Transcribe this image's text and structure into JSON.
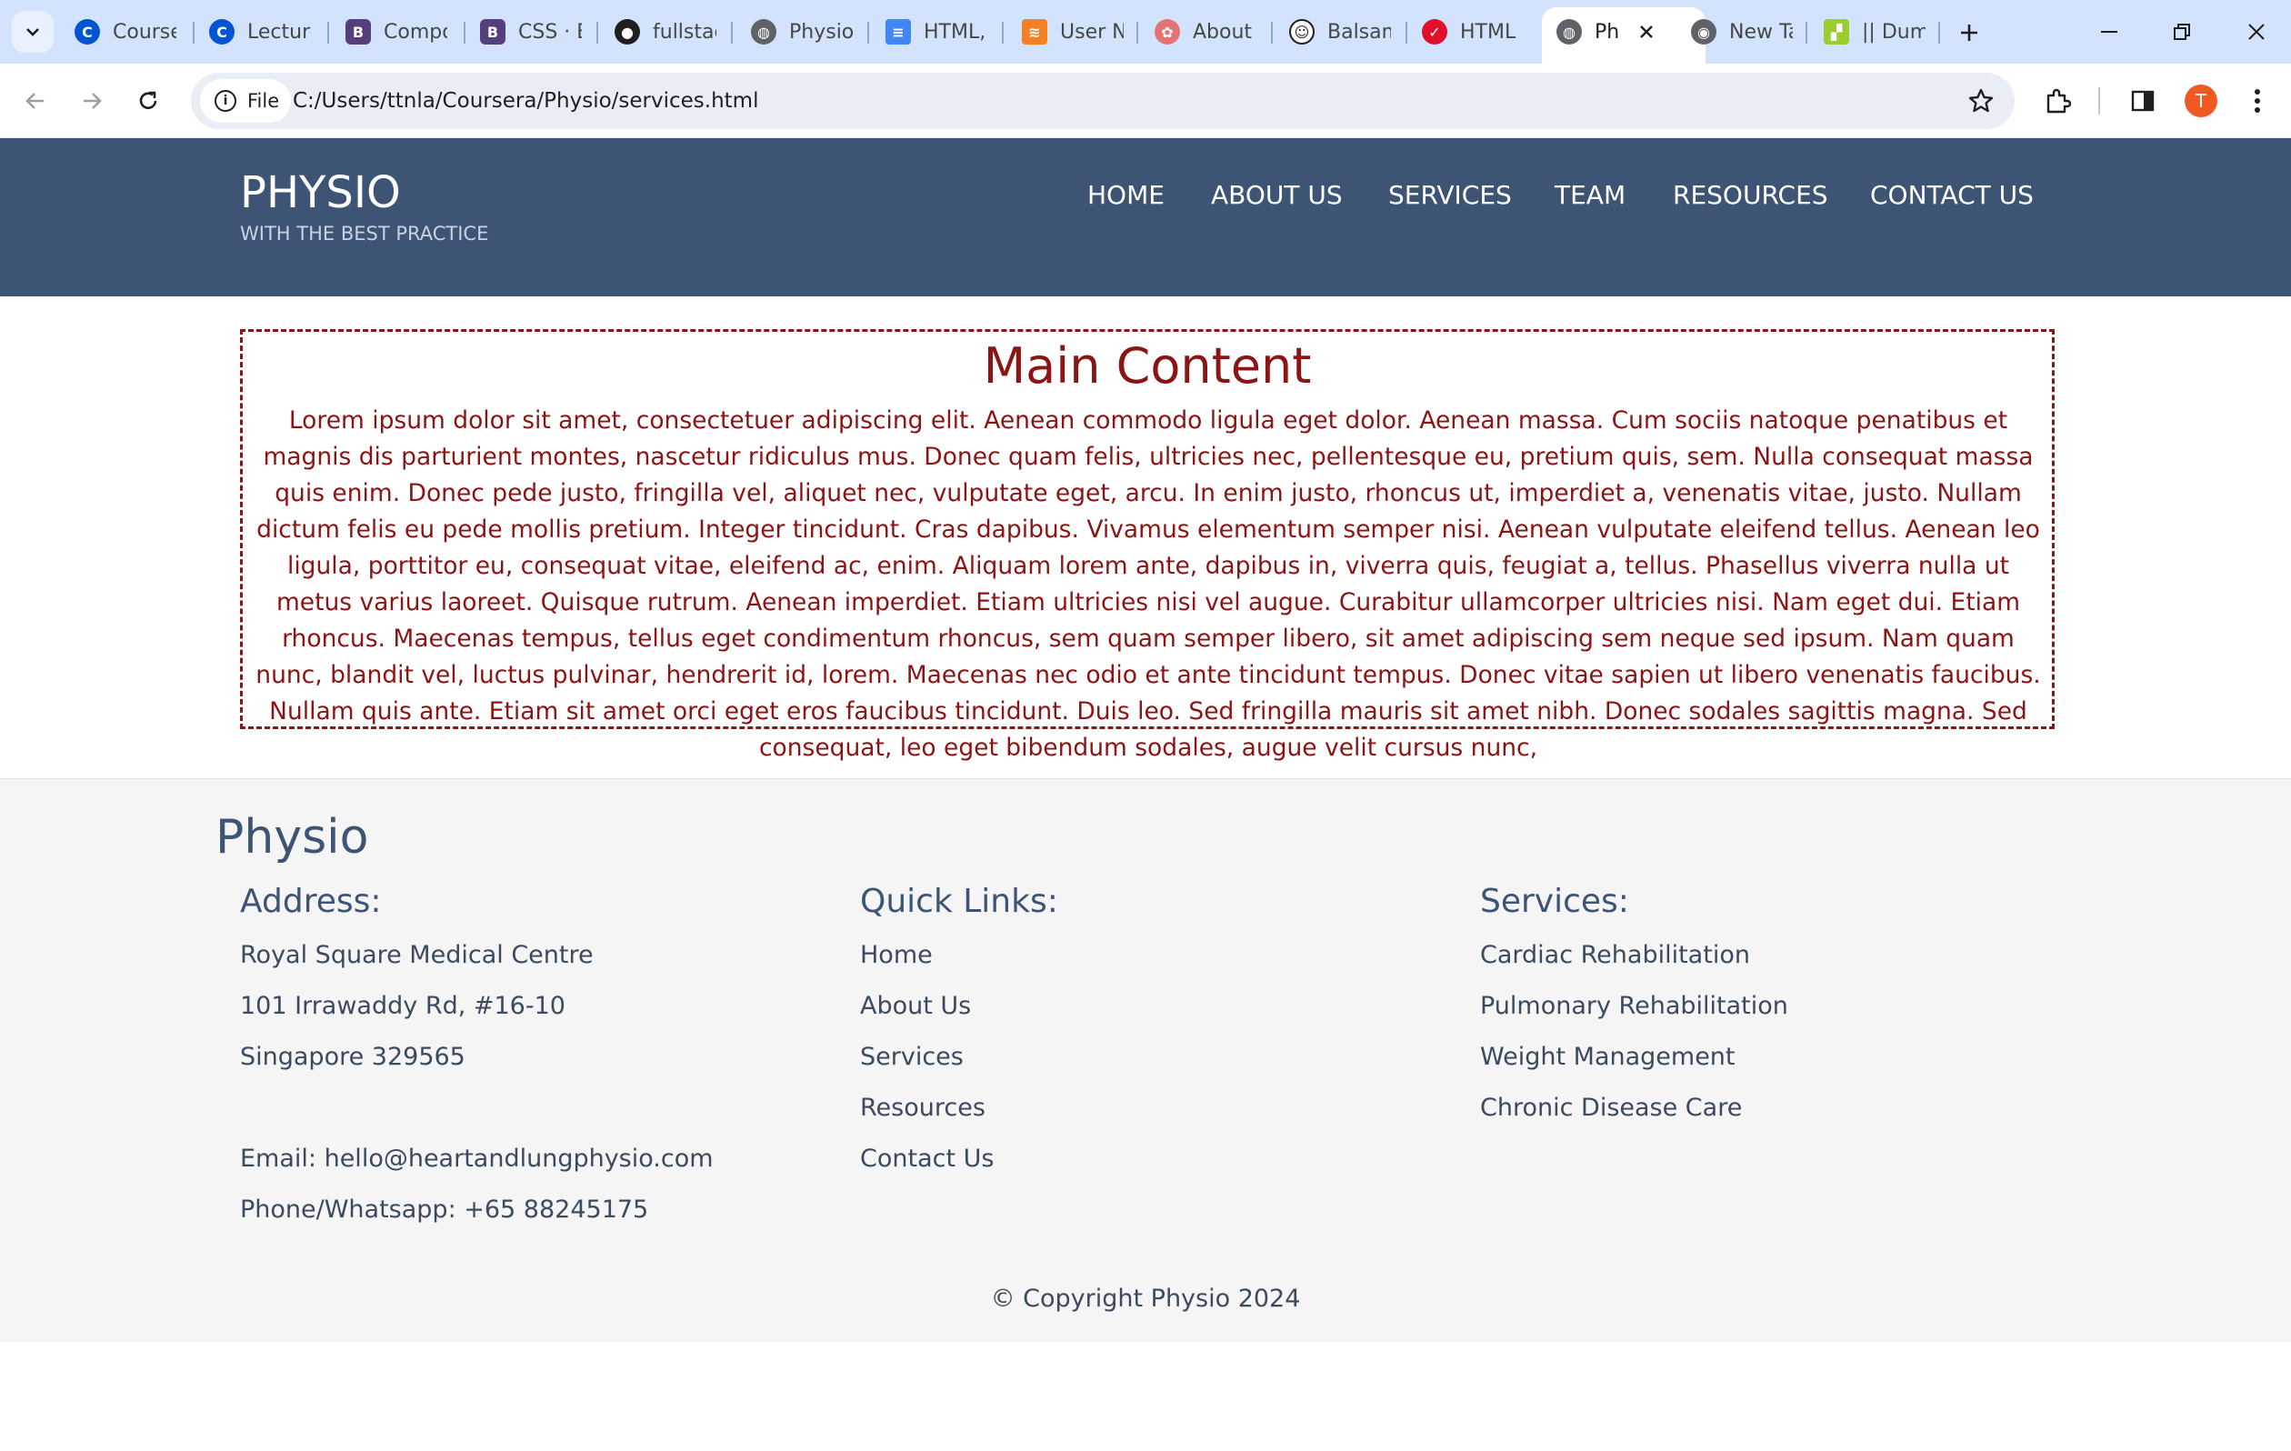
{
  "browser": {
    "tabs": [
      {
        "title": "Course",
        "icon": "coursera-icon",
        "color": "#0056d2"
      },
      {
        "title": "Lecture",
        "icon": "coursera-icon",
        "color": "#0056d2"
      },
      {
        "title": "Compo",
        "icon": "bootstrap-icon",
        "color": "#563d7c"
      },
      {
        "title": "CSS · B",
        "icon": "bootstrap-icon",
        "color": "#563d7c"
      },
      {
        "title": "fullstac",
        "icon": "github-icon",
        "color": "#1f1f1f"
      },
      {
        "title": "Physio",
        "icon": "globe-icon",
        "color": "#5f6368"
      },
      {
        "title": "HTML,",
        "icon": "docs-icon",
        "color": "#4285f4"
      },
      {
        "title": "User N",
        "icon": "stackoverflow-icon",
        "color": "#f48024"
      },
      {
        "title": "About",
        "icon": "about-icon",
        "color": "#e57373"
      },
      {
        "title": "Balsam",
        "icon": "smiley-icon",
        "color": "#1f1f1f"
      },
      {
        "title": "HTML (",
        "icon": "htmlcheck-icon",
        "color": "#e0102b"
      },
      {
        "title": "Ph",
        "icon": "globe-icon",
        "color": "#5f6368",
        "active": true
      },
      {
        "title": "New Ta",
        "icon": "chrome-icon",
        "color": "#5f6368"
      },
      {
        "title": "|| Dum",
        "icon": "dummy-icon",
        "color": "#9acd32"
      }
    ],
    "file_chip": "File",
    "url": "C:/Users/ttnla/Coursera/Physio/services.html",
    "avatar_letter": "T"
  },
  "header": {
    "brand": "PHYSIO",
    "tagline": "WITH THE BEST PRACTICE",
    "nav": [
      "HOME",
      "ABOUT US",
      "SERVICES",
      "TEAM",
      "RESOURCES",
      "CONTACT US"
    ]
  },
  "main": {
    "title": "Main Content",
    "text": "Lorem ipsum dolor sit amet, consectetuer adipiscing elit. Aenean commodo ligula eget dolor. Aenean massa. Cum sociis natoque penatibus et magnis dis parturient montes, nascetur ridiculus mus. Donec quam felis, ultricies nec, pellentesque eu, pretium quis, sem. Nulla consequat massa quis enim. Donec pede justo, fringilla vel, aliquet nec, vulputate eget, arcu. In enim justo, rhoncus ut, imperdiet a, venenatis vitae, justo. Nullam dictum felis eu pede mollis pretium. Integer tincidunt. Cras dapibus. Vivamus elementum semper nisi. Aenean vulputate eleifend tellus. Aenean leo ligula, porttitor eu, consequat vitae, eleifend ac, enim. Aliquam lorem ante, dapibus in, viverra quis, feugiat a, tellus. Phasellus viverra nulla ut metus varius laoreet. Quisque rutrum. Aenean imperdiet. Etiam ultricies nisi vel augue. Curabitur ullamcorper ultricies nisi. Nam eget dui. Etiam rhoncus. Maecenas tempus, tellus eget condimentum rhoncus, sem quam semper libero, sit amet adipiscing sem neque sed ipsum. Nam quam nunc, blandit vel, luctus pulvinar, hendrerit id, lorem. Maecenas nec odio et ante tincidunt tempus. Donec vitae sapien ut libero venenatis faucibus. Nullam quis ante. Etiam sit amet orci eget eros faucibus tincidunt. Duis leo. Sed fringilla mauris sit amet nibh. Donec sodales sagittis magna. Sed consequat, leo eget bibendum sodales, augue velit cursus nunc,"
  },
  "footer": {
    "brand": "Physio",
    "address": {
      "heading": "Address:",
      "lines": [
        "Royal Square Medical Centre",
        "101 Irrawaddy Rd, #16-10",
        "Singapore 329565"
      ],
      "email": "Email: hello@heartandlungphysio.com",
      "phone": "Phone/Whatsapp: +65 88245175"
    },
    "quick_links": {
      "heading": "Quick Links:",
      "items": [
        "Home",
        "About Us",
        "Services",
        "Resources",
        "Contact Us"
      ]
    },
    "services": {
      "heading": "Services:",
      "items": [
        "Cardiac Rehabilitation",
        "Pulmonary Rehabilitation",
        "Weight Management",
        "Chronic Disease Care"
      ]
    },
    "copyright": "© Copyright Physio 2024"
  },
  "colors": {
    "header_bg": "#3d5475",
    "accent_red": "#8b1414",
    "footer_bg": "#f5f5f5",
    "tabbar_bg": "#d3e3fd"
  }
}
